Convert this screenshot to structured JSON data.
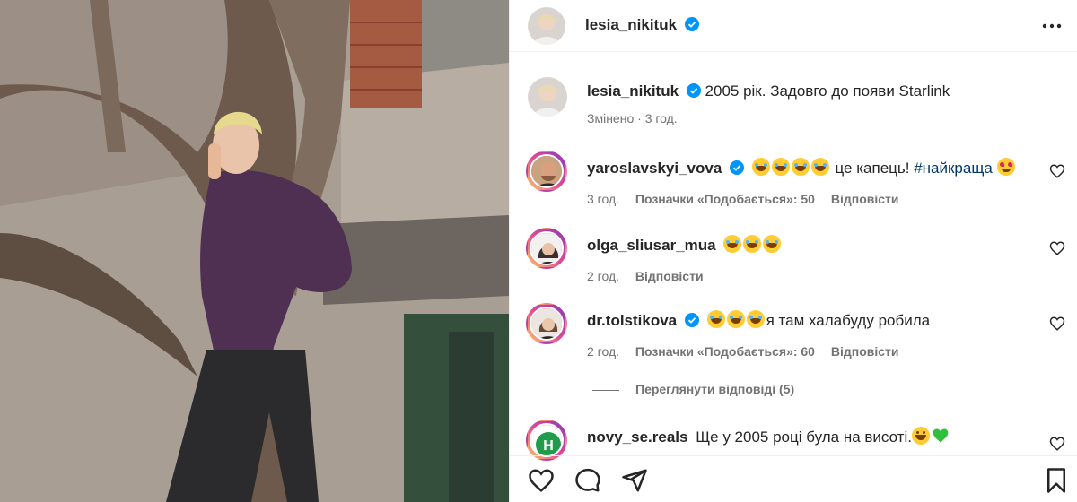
{
  "post": {
    "author": "lesia_nikituk",
    "caption": "2005 рік. Задовго до появи Starlink",
    "edited_label": "Змінено",
    "time": "3 год."
  },
  "comments": [
    {
      "username": "yaroslavskyi_vova",
      "verified": true,
      "emojis": [
        "laugh",
        "laugh",
        "laugh",
        "laugh"
      ],
      "text": "це капець!",
      "hashtag": "#найкраща",
      "trailing_emoji": "hearteyes",
      "time": "3 год.",
      "likes": "Позначки «Подобається»: 50",
      "reply": "Відповісти"
    },
    {
      "username": "olga_sliusar_mua",
      "verified": false,
      "emojis": [
        "laugh",
        "laugh",
        "laugh"
      ],
      "text": "",
      "time": "2 год.",
      "reply": "Відповісти"
    },
    {
      "username": "dr.tolstikova",
      "verified": true,
      "emojis": [
        "laugh",
        "laugh",
        "laugh"
      ],
      "text": "я там халабуду робила",
      "time": "2 год.",
      "likes": "Позначки «Подобається»: 60",
      "reply": "Відповісти",
      "view_replies": "Переглянути відповіді (5)"
    },
    {
      "username": "novy_se.reals",
      "verified": false,
      "text": "Ще у 2005 році була на висоті.",
      "trailing_emojis": [
        "grin",
        "greenheart"
      ]
    }
  ],
  "icons": {
    "verified_color": "#0095f6",
    "like": "heart-outline-icon",
    "comment": "comment-icon",
    "share": "share-icon",
    "save": "bookmark-icon",
    "more": "more-options-icon"
  }
}
